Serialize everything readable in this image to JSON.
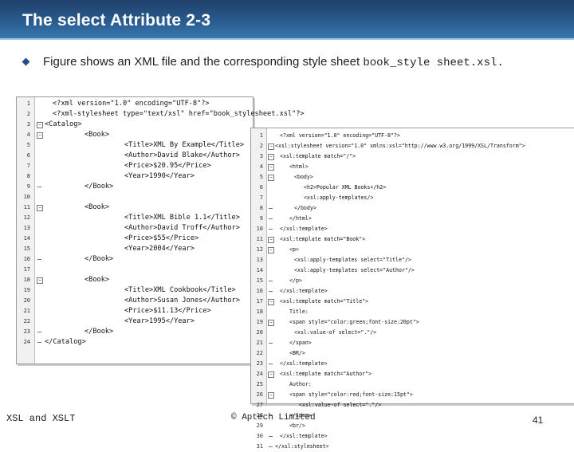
{
  "slide": {
    "title": "The select Attribute 2-3",
    "intro_text": "Figure shows an XML file and the corresponding style sheet ",
    "intro_code": "book_style sheet.xsl.",
    "footer_left": "XSL and XSLT",
    "footer_center": "© Aptech Limited",
    "page_number": "41"
  },
  "xml_listing": [
    {
      "n": "1",
      "fold": "",
      "indent": 1,
      "text": "<?xml version=\"1.0\" encoding=\"UTF-8\"?>"
    },
    {
      "n": "2",
      "fold": "",
      "indent": 1,
      "text": "<?xml-stylesheet type=\"text/xsl\" href=\"book_stylesheet.xsl\"?>"
    },
    {
      "n": "3",
      "fold": "open",
      "indent": 0,
      "text": "<Catalog>"
    },
    {
      "n": "4",
      "fold": "open",
      "indent": 5,
      "text": "<Book>"
    },
    {
      "n": "5",
      "fold": "",
      "indent": 10,
      "text": "<Title>XML By Example</Title>"
    },
    {
      "n": "6",
      "fold": "",
      "indent": 10,
      "text": "<Author>David Blake</Author>"
    },
    {
      "n": "7",
      "fold": "",
      "indent": 10,
      "text": "<Price>$20.95</Price>"
    },
    {
      "n": "8",
      "fold": "",
      "indent": 10,
      "text": "<Year>1990</Year>"
    },
    {
      "n": "9",
      "fold": "end",
      "indent": 5,
      "text": "</Book>"
    },
    {
      "n": "10",
      "fold": "",
      "indent": 0,
      "text": ""
    },
    {
      "n": "11",
      "fold": "open",
      "indent": 5,
      "text": "<Book>"
    },
    {
      "n": "12",
      "fold": "",
      "indent": 10,
      "text": "<Title>XML Bible 1.1</Title>"
    },
    {
      "n": "13",
      "fold": "",
      "indent": 10,
      "text": "<Author>David Troff</Author>"
    },
    {
      "n": "14",
      "fold": "",
      "indent": 10,
      "text": "<Price>$55</Price>"
    },
    {
      "n": "15",
      "fold": "",
      "indent": 10,
      "text": "<Year>2004</Year>"
    },
    {
      "n": "16",
      "fold": "end",
      "indent": 5,
      "text": "</Book>"
    },
    {
      "n": "17",
      "fold": "",
      "indent": 0,
      "text": ""
    },
    {
      "n": "18",
      "fold": "open",
      "indent": 5,
      "text": "<Book>"
    },
    {
      "n": "19",
      "fold": "",
      "indent": 10,
      "text": "<Title>XML Cookbook</Title>"
    },
    {
      "n": "20",
      "fold": "",
      "indent": 10,
      "text": "<Author>Susan Jones</Author>"
    },
    {
      "n": "21",
      "fold": "",
      "indent": 10,
      "text": "<Price>$11.13</Price>"
    },
    {
      "n": "22",
      "fold": "",
      "indent": 10,
      "text": "<Year>1995</Year>"
    },
    {
      "n": "23",
      "fold": "end",
      "indent": 5,
      "text": "</Book>"
    },
    {
      "n": "24",
      "fold": "end",
      "indent": 0,
      "text": "</Catalog>"
    }
  ],
  "xsl_listing": [
    {
      "n": "1",
      "fold": "",
      "indent": 1,
      "text": "<?xml version=\"1.0\" encoding=\"UTF-8\"?>"
    },
    {
      "n": "2",
      "fold": "open",
      "indent": 0,
      "text": "<xsl:stylesheet version=\"1.0\" xmlns:xsl=\"http://www.w3.org/1999/XSL/Transform\">"
    },
    {
      "n": "3",
      "fold": "open",
      "indent": 1,
      "text": "<xsl:template match=\"/\">"
    },
    {
      "n": "4",
      "fold": "open",
      "indent": 3,
      "text": "<html>"
    },
    {
      "n": "5",
      "fold": "open",
      "indent": 4,
      "text": "<body>"
    },
    {
      "n": "6",
      "fold": "",
      "indent": 6,
      "text": "<h2>Popular XML Books</h2>"
    },
    {
      "n": "7",
      "fold": "",
      "indent": 6,
      "text": "<xsl:apply-templates/>"
    },
    {
      "n": "8",
      "fold": "end",
      "indent": 4,
      "text": "</body>"
    },
    {
      "n": "9",
      "fold": "end",
      "indent": 3,
      "text": "</html>"
    },
    {
      "n": "10",
      "fold": "end",
      "indent": 1,
      "text": "</xsl:template>"
    },
    {
      "n": "11",
      "fold": "open",
      "indent": 1,
      "text": "<xsl:template match=\"Book\">"
    },
    {
      "n": "12",
      "fold": "open",
      "indent": 3,
      "text": "<p>"
    },
    {
      "n": "13",
      "fold": "",
      "indent": 4,
      "text": "<xsl:apply-templates select=\"Title\"/>"
    },
    {
      "n": "14",
      "fold": "",
      "indent": 4,
      "text": "<xsl:apply-templates select=\"Author\"/>"
    },
    {
      "n": "15",
      "fold": "end",
      "indent": 3,
      "text": "</p>"
    },
    {
      "n": "16",
      "fold": "end",
      "indent": 1,
      "text": "</xsl:template>"
    },
    {
      "n": "17",
      "fold": "open",
      "indent": 1,
      "text": "<xsl:template match=\"Title\">"
    },
    {
      "n": "18",
      "fold": "",
      "indent": 3,
      "text": "Title:"
    },
    {
      "n": "19",
      "fold": "open",
      "indent": 3,
      "text": "<span style=\"color:green;font-size:20pt\">"
    },
    {
      "n": "20",
      "fold": "",
      "indent": 4,
      "text": "<xsl:value-of select=\".\"/>"
    },
    {
      "n": "21",
      "fold": "end",
      "indent": 3,
      "text": "</span>"
    },
    {
      "n": "22",
      "fold": "",
      "indent": 3,
      "text": "<BR/>"
    },
    {
      "n": "23",
      "fold": "end",
      "indent": 1,
      "text": "</xsl:template>"
    },
    {
      "n": "24",
      "fold": "open",
      "indent": 1,
      "text": "<xsl:template match=\"Author\">"
    },
    {
      "n": "25",
      "fold": "",
      "indent": 3,
      "text": "Author:"
    },
    {
      "n": "26",
      "fold": "open",
      "indent": 3,
      "text": "<span style=\"color:red;font-size:15pt\">"
    },
    {
      "n": "27",
      "fold": "",
      "indent": 5,
      "text": "<xsl:value-of select=\".\"/>"
    },
    {
      "n": "28",
      "fold": "end",
      "indent": 3,
      "text": "</span>"
    },
    {
      "n": "29",
      "fold": "",
      "indent": 3,
      "text": "<br/>"
    },
    {
      "n": "30",
      "fold": "end",
      "indent": 1,
      "text": "</xsl:template>"
    },
    {
      "n": "31",
      "fold": "end",
      "indent": 0,
      "text": "</xsl:stylesheet>"
    }
  ],
  "colors": {
    "header_top": "#1f3f6a",
    "header_bottom": "#3b7bb5",
    "bullet": "#1f4f86"
  }
}
